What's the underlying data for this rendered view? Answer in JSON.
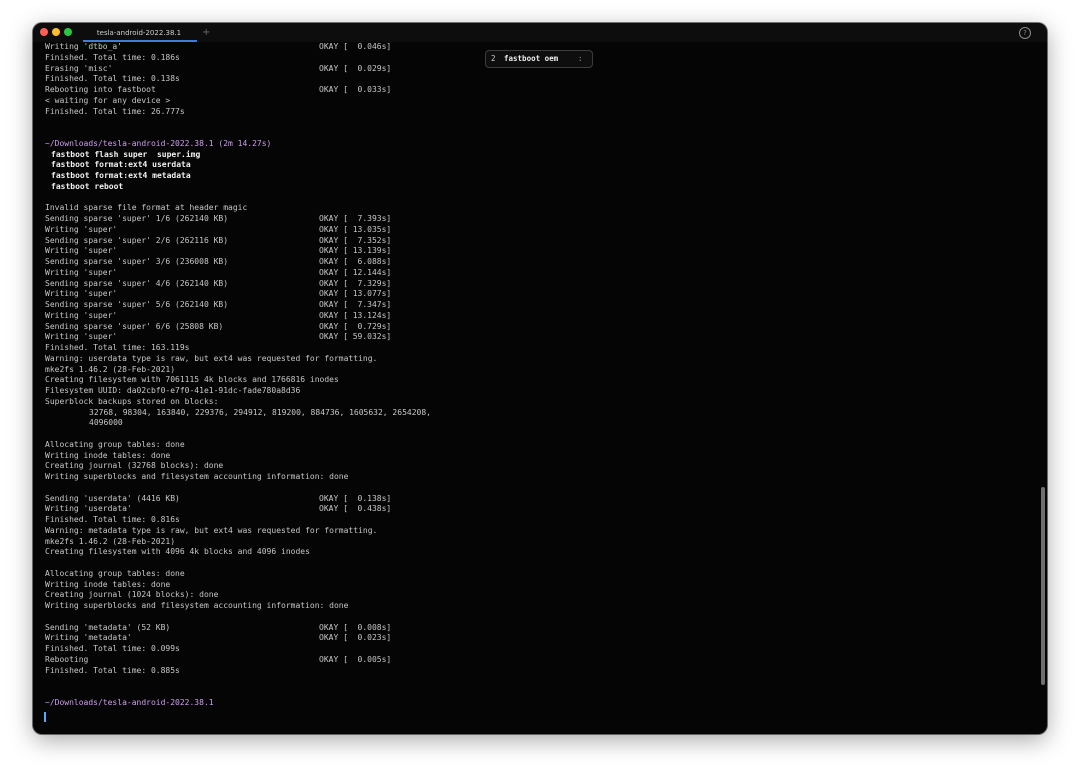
{
  "window": {
    "tab_title": "tesla-android-2022.38.1",
    "new_tab": "+",
    "help_glyph": "?"
  },
  "colors": {
    "background": "#050505",
    "prompt": "#d29ef0",
    "accent": "#3e7ed8",
    "cursor": "#56a7ff"
  },
  "popup": {
    "index": "2",
    "command": "fastboot oem",
    "end": ":"
  },
  "terminal_lines": [
    {
      "text": "Writing 'dtbo_a'",
      "status": "OKAY [  0.046s]"
    },
    {
      "text": "Finished. Total time: 0.186s"
    },
    {
      "text": "Erasing 'misc'",
      "status": "OKAY [  0.029s]"
    },
    {
      "text": "Finished. Total time: 0.138s"
    },
    {
      "text": "Rebooting into fastboot",
      "status": "OKAY [  0.033s]"
    },
    {
      "text": "< waiting for any device >"
    },
    {
      "text": "Finished. Total time: 26.777s"
    },
    {
      "text": ""
    },
    {
      "text": ""
    },
    {
      "text": "~/Downloads/tesla-android-2022.38.1 (2m 14.27s)",
      "kind": "prompt"
    },
    {
      "text": "fastboot flash super  super.img",
      "kind": "cmd"
    },
    {
      "text": "fastboot format:ext4 userdata",
      "kind": "cmd"
    },
    {
      "text": "fastboot format:ext4 metadata",
      "kind": "cmd"
    },
    {
      "text": "fastboot reboot",
      "kind": "cmd"
    },
    {
      "text": ""
    },
    {
      "text": "Invalid sparse file format at header magic"
    },
    {
      "text": "Sending sparse 'super' 1/6 (262140 KB)",
      "status": "OKAY [  7.393s]"
    },
    {
      "text": "Writing 'super'",
      "status": "OKAY [ 13.035s]"
    },
    {
      "text": "Sending sparse 'super' 2/6 (262116 KB)",
      "status": "OKAY [  7.352s]"
    },
    {
      "text": "Writing 'super'",
      "status": "OKAY [ 13.139s]"
    },
    {
      "text": "Sending sparse 'super' 3/6 (236008 KB)",
      "status": "OKAY [  6.088s]"
    },
    {
      "text": "Writing 'super'",
      "status": "OKAY [ 12.144s]"
    },
    {
      "text": "Sending sparse 'super' 4/6 (262140 KB)",
      "status": "OKAY [  7.329s]"
    },
    {
      "text": "Writing 'super'",
      "status": "OKAY [ 13.077s]"
    },
    {
      "text": "Sending sparse 'super' 5/6 (262140 KB)",
      "status": "OKAY [  7.347s]"
    },
    {
      "text": "Writing 'super'",
      "status": "OKAY [ 13.124s]"
    },
    {
      "text": "Sending sparse 'super' 6/6 (25808 KB)",
      "status": "OKAY [  0.729s]"
    },
    {
      "text": "Writing 'super'",
      "status": "OKAY [ 59.032s]"
    },
    {
      "text": "Finished. Total time: 163.119s"
    },
    {
      "text": "Warning: userdata type is raw, but ext4 was requested for formatting."
    },
    {
      "text": "mke2fs 1.46.2 (28-Feb-2021)"
    },
    {
      "text": "Creating filesystem with 7061115 4k blocks and 1766816 inodes"
    },
    {
      "text": "Filesystem UUID: da02cbf0-e7f0-41e1-91dc-fade780a8d36"
    },
    {
      "text": "Superblock backups stored on blocks:"
    },
    {
      "text": "32768, 98304, 163840, 229376, 294912, 819200, 884736, 1605632, 2654208,",
      "kind": "indent"
    },
    {
      "text": "4096000",
      "kind": "indent"
    },
    {
      "text": ""
    },
    {
      "text": "Allocating group tables: done"
    },
    {
      "text": "Writing inode tables: done"
    },
    {
      "text": "Creating journal (32768 blocks): done"
    },
    {
      "text": "Writing superblocks and filesystem accounting information: done"
    },
    {
      "text": ""
    },
    {
      "text": "Sending 'userdata' (4416 KB)",
      "status": "OKAY [  0.138s]"
    },
    {
      "text": "Writing 'userdata'",
      "status": "OKAY [  0.438s]"
    },
    {
      "text": "Finished. Total time: 0.816s"
    },
    {
      "text": "Warning: metadata type is raw, but ext4 was requested for formatting."
    },
    {
      "text": "mke2fs 1.46.2 (28-Feb-2021)"
    },
    {
      "text": "Creating filesystem with 4096 4k blocks and 4096 inodes"
    },
    {
      "text": ""
    },
    {
      "text": "Allocating group tables: done"
    },
    {
      "text": "Writing inode tables: done"
    },
    {
      "text": "Creating journal (1024 blocks): done"
    },
    {
      "text": "Writing superblocks and filesystem accounting information: done"
    },
    {
      "text": ""
    },
    {
      "text": "Sending 'metadata' (52 KB)",
      "status": "OKAY [  0.008s]"
    },
    {
      "text": "Writing 'metadata'",
      "status": "OKAY [  0.023s]"
    },
    {
      "text": "Finished. Total time: 0.099s"
    },
    {
      "text": "Rebooting",
      "status": "OKAY [  0.005s]"
    },
    {
      "text": "Finished. Total time: 0.885s"
    },
    {
      "text": ""
    },
    {
      "text": ""
    },
    {
      "text": "~/Downloads/tesla-android-2022.38.1",
      "kind": "prompt"
    }
  ]
}
